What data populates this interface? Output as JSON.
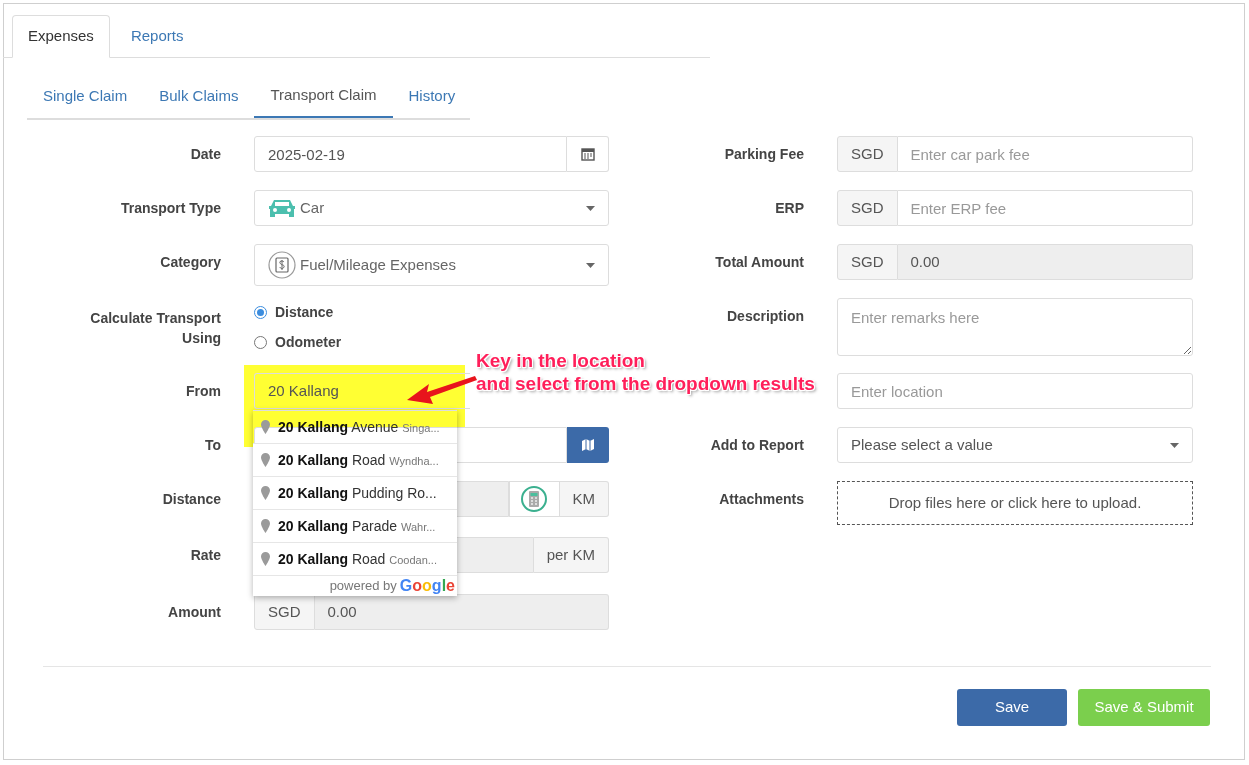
{
  "top_tabs": [
    {
      "label": "Expenses",
      "selected": true
    },
    {
      "label": "Reports",
      "selected": false
    }
  ],
  "sub_tabs": [
    {
      "label": "Single Claim",
      "selected": false
    },
    {
      "label": "Bulk Claims",
      "selected": false
    },
    {
      "label": "Transport Claim",
      "selected": true
    },
    {
      "label": "History",
      "selected": false
    }
  ],
  "left_fields": [
    {
      "kind": "date",
      "label": "Date",
      "value": "2025-02-19"
    },
    {
      "kind": "vehicle-select",
      "label": "Transport Type",
      "value": "Car"
    },
    {
      "kind": "category-select",
      "label": "Category",
      "value": "Fuel/Mileage Expenses"
    },
    {
      "kind": "radio",
      "label": "Calculate Transport Using",
      "options": [
        {
          "label": "Distance",
          "selected": true
        },
        {
          "label": "Odometer",
          "selected": false
        }
      ]
    },
    {
      "kind": "location",
      "label": "From",
      "value": "20 Kallang"
    },
    {
      "kind": "map",
      "label": "To"
    },
    {
      "kind": "calc",
      "label": "Distance",
      "suffix": "KM"
    },
    {
      "kind": "suffix",
      "label": "Rate",
      "suffix": "per KM"
    },
    {
      "kind": "prefix",
      "label": "Amount",
      "prefix": "SGD",
      "value": "0.00"
    }
  ],
  "right_fields": [
    {
      "kind": "prefix-input",
      "label": "Parking Fee",
      "prefix": "SGD",
      "placeholder": "Enter car park fee"
    },
    {
      "kind": "prefix-input",
      "label": "ERP",
      "prefix": "SGD",
      "placeholder": "Enter ERP fee"
    },
    {
      "kind": "prefix",
      "label": "Total Amount",
      "prefix": "SGD",
      "value": "0.00"
    },
    {
      "kind": "textarea",
      "label": "Description",
      "placeholder": "Enter remarks here"
    },
    {
      "kind": "input",
      "placeholder": "Enter location"
    },
    {
      "kind": "select",
      "label": "Add to Report",
      "value": "Please select a value"
    },
    {
      "kind": "dropzone",
      "label": "Attachments",
      "text": "Drop files here or click here to upload."
    }
  ],
  "suggestions": [
    {
      "match": "20 Kallang",
      "main": "Avenue",
      "secondary": "Singa..."
    },
    {
      "match": "20 Kallang",
      "main": "Road",
      "secondary": "Wyndha..."
    },
    {
      "match": "20 Kallang",
      "main": "Pudding Ro..."
    },
    {
      "match": "20 Kallang",
      "main": "Parade",
      "secondary": "Wahr..."
    },
    {
      "match": "20 Kallang",
      "main": "Road",
      "secondary": "Coodan..."
    }
  ],
  "attribution": {
    "prefix": "powered by",
    "brand": "Google"
  },
  "annotation": {
    "lines": [
      "Key in the location",
      "and select from the dropdown results"
    ]
  },
  "buttons": [
    {
      "kind": "primary",
      "label": "Save"
    },
    {
      "kind": "success",
      "label": "Save & Submit"
    }
  ]
}
